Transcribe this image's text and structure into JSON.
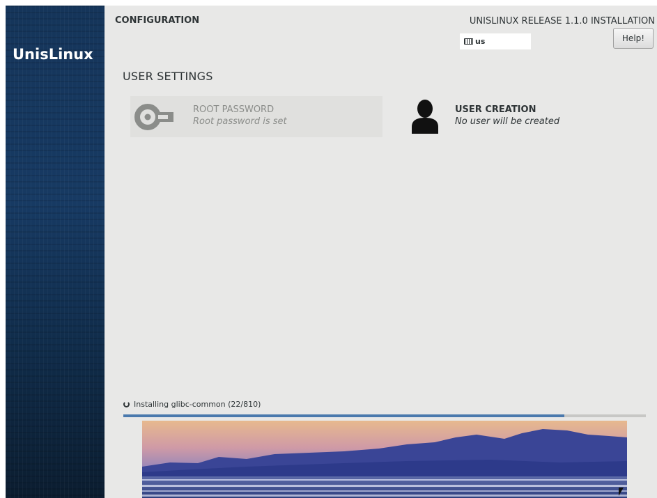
{
  "sidebar": {
    "brand": "UnisLinux"
  },
  "header": {
    "section": "CONFIGURATION",
    "release": "UNISLINUX RELEASE 1.1.0 INSTALLATION",
    "keyboard_layout": "us",
    "help_label": "Help!"
  },
  "user_settings": {
    "title": "USER SETTINGS",
    "spokes": [
      {
        "name": "ROOT PASSWORD",
        "status": "Root password is set",
        "icon": "key-icon"
      },
      {
        "name": "USER CREATION",
        "status": "No user will be created",
        "icon": "user-icon"
      }
    ]
  },
  "progress": {
    "label": "Installing glibc-common (22/810)",
    "fraction": 0.844
  },
  "colors": {
    "sidebar": "#173a63",
    "main_background": "#e8e8e7",
    "progress_fill": "#4a79ad",
    "text": "#2e3436"
  }
}
